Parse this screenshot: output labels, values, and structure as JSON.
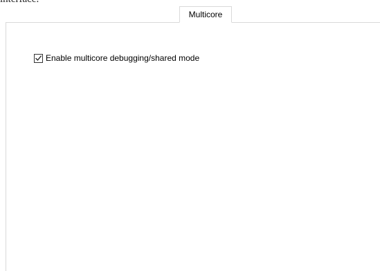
{
  "top_text": "interface.",
  "tabs": [
    {
      "label": "Multicore",
      "selected": true
    }
  ],
  "multicore": {
    "enable_checkbox": {
      "label": "Enable multicore debugging/shared mode",
      "checked": true
    }
  }
}
